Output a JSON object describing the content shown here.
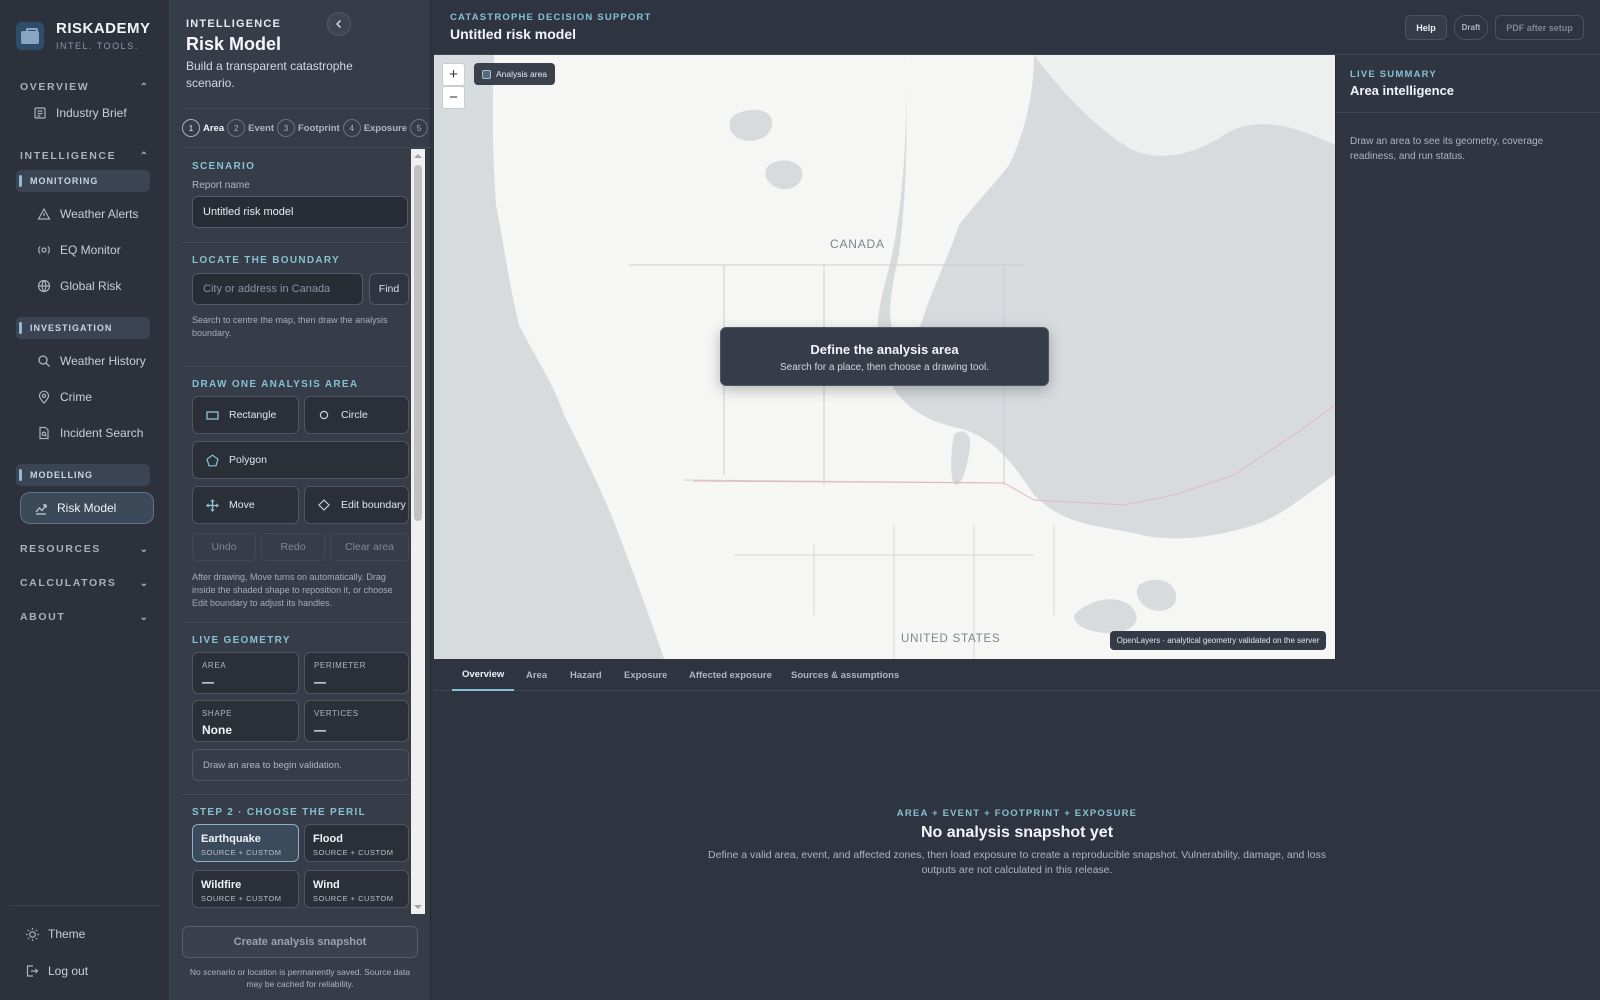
{
  "brand": {
    "name": "RISKADEMY",
    "tagline": "INTEL. TOOLS."
  },
  "nav": {
    "overview": {
      "label": "OVERVIEW",
      "items": [
        "Industry Brief"
      ]
    },
    "intelligence": {
      "label": "INTELLIGENCE"
    },
    "monitoring": {
      "label": "MONITORING",
      "items": [
        "Weather Alerts",
        "EQ Monitor",
        "Global Risk"
      ]
    },
    "investigation": {
      "label": "INVESTIGATION",
      "items": [
        "Weather History",
        "Crime",
        "Incident Search"
      ]
    },
    "modelling": {
      "label": "MODELLING",
      "items": [
        "Risk Model"
      ]
    },
    "resources": "RESOURCES",
    "calculators": "CALCULATORS",
    "about": "ABOUT",
    "theme": "Theme",
    "logout": "Log out"
  },
  "panel": {
    "eyebrow": "INTELLIGENCE",
    "title": "Risk Model",
    "description": "Build a transparent catastrophe scenario.",
    "steps": [
      {
        "num": "1",
        "label": "Area"
      },
      {
        "num": "2",
        "label": "Event"
      },
      {
        "num": "3",
        "label": "Footprint"
      },
      {
        "num": "4",
        "label": "Exposure"
      },
      {
        "num": "5",
        "label": ""
      }
    ],
    "scenario": {
      "heading": "SCENARIO",
      "report_label": "Report name",
      "report_value": "Untitled risk model"
    },
    "locate": {
      "heading": "LOCATE THE BOUNDARY",
      "placeholder": "City or address in Canada",
      "find": "Find",
      "note": "Search to centre the map, then draw the analysis boundary."
    },
    "draw": {
      "heading": "DRAW ONE ANALYSIS AREA",
      "rectangle": "Rectangle",
      "circle": "Circle",
      "polygon": "Polygon",
      "move": "Move",
      "edit": "Edit boundary",
      "undo": "Undo",
      "redo": "Redo",
      "clear": "Clear area",
      "note": "After drawing, Move turns on automatically. Drag inside the shaded shape to reposition it, or choose Edit boundary to adjust its handles."
    },
    "geometry": {
      "heading": "LIVE GEOMETRY",
      "area_k": "AREA",
      "area_v": "—",
      "perimeter_k": "PERIMETER",
      "perimeter_v": "—",
      "shape_k": "SHAPE",
      "shape_v": "None",
      "vertices_k": "VERTICES",
      "vertices_v": "—",
      "message": "Draw an area to begin validation."
    },
    "peril": {
      "heading": "STEP 2 · CHOOSE THE PERIL",
      "options": [
        {
          "name": "Earthquake",
          "sub": "SOURCE + CUSTOM"
        },
        {
          "name": "Flood",
          "sub": "SOURCE + CUSTOM"
        },
        {
          "name": "Wildfire",
          "sub": "SOURCE + CUSTOM"
        },
        {
          "name": "Wind",
          "sub": "SOURCE + CUSTOM"
        }
      ]
    },
    "create": "Create analysis snapshot",
    "footnote": "No scenario or location is permanently saved. Source data may be cached for reliability."
  },
  "header": {
    "eyebrow": "CATASTROPHE DECISION SUPPORT",
    "title": "Untitled risk model",
    "help": "Help",
    "draft": "Draft",
    "pdf": "PDF after setup"
  },
  "map": {
    "chip": "Analysis area",
    "canada": "CANADA",
    "us": "UNITED STATES",
    "overlay_title": "Define the analysis area",
    "overlay_text": "Search for a place, then choose a drawing tool.",
    "attribution": "OpenLayers · analytical geometry validated on the server"
  },
  "summary": {
    "eyebrow": "LIVE SUMMARY",
    "title": "Area intelligence",
    "text": "Draw an area to see its geometry, coverage readiness, and run status."
  },
  "tabs": [
    "Overview",
    "Area",
    "Hazard",
    "Exposure",
    "Affected exposure",
    "Sources & assumptions"
  ],
  "empty": {
    "eyebrow": "AREA + EVENT + FOOTPRINT + EXPOSURE",
    "title": "No analysis snapshot yet",
    "text": "Define a valid area, event, and affected zones, then load exposure to create a reproducible snapshot. Vulnerability, damage, and loss outputs are not calculated in this release."
  },
  "colors": {
    "accent": "#86c0d3",
    "background": "#2e3440",
    "panel": "#363c48",
    "land": "#f6f6f4",
    "water": "#d7dbde"
  }
}
